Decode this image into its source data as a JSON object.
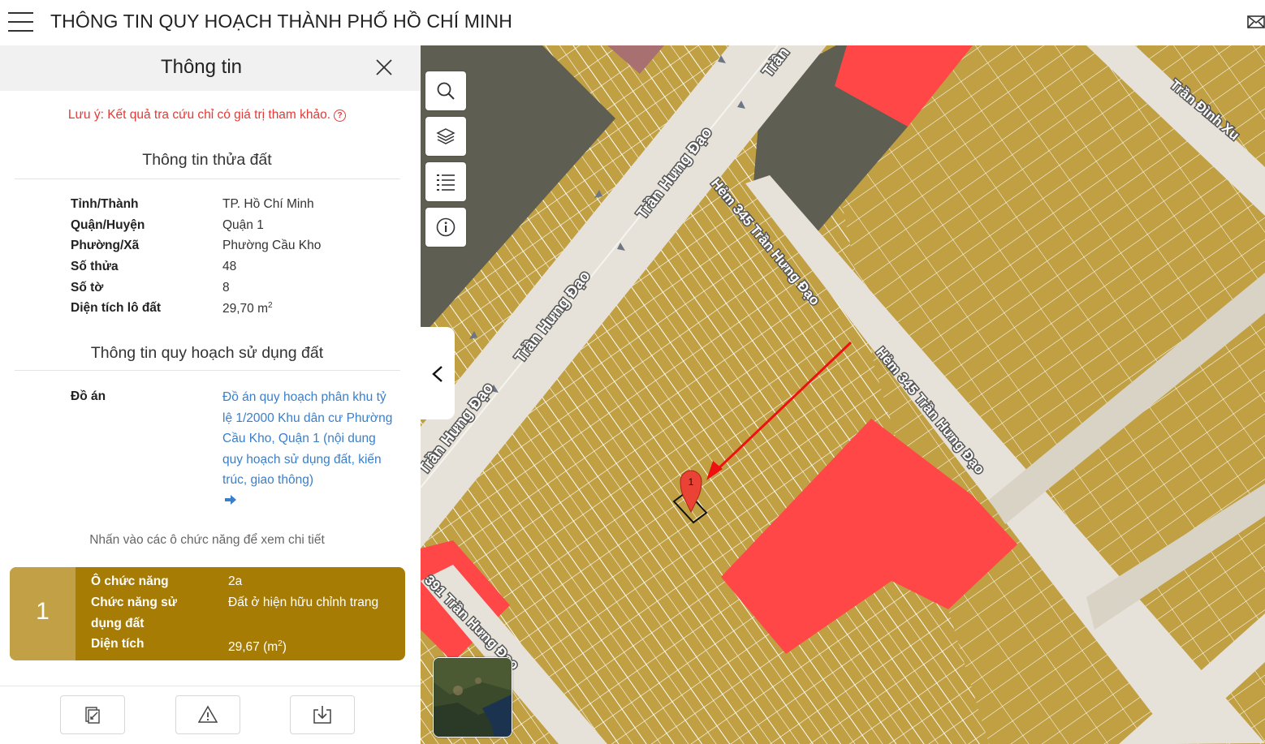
{
  "header": {
    "title": "THÔNG TIN QUY HOẠCH THÀNH PHỐ HỒ CHÍ MINH",
    "menu_icon": "hamburger-menu-icon",
    "mail_icon": "mail-icon"
  },
  "panel": {
    "title": "Thông tin",
    "note": "Lưu ý: Kết quả tra cứu chỉ có giá trị tham khảo.",
    "land_section_title": "Thông tin thửa đất",
    "land_info": [
      {
        "label": "Tỉnh/Thành",
        "value": "TP. Hồ Chí Minh"
      },
      {
        "label": "Quận/Huyện",
        "value": "Quận 1"
      },
      {
        "label": "Phường/Xã",
        "value": "Phường Cầu Kho"
      },
      {
        "label": "Số thửa",
        "value": "48"
      },
      {
        "label": "Số tờ",
        "value": "8"
      },
      {
        "label": "Diện tích lô đất",
        "value": "29,70 m",
        "value_sup": "2"
      }
    ],
    "planning_section_title": "Thông tin quy hoạch sử dụng đất",
    "project_label": "Đồ án",
    "project_link": "Đồ án quy hoạch phân khu tỷ lệ 1/2000 Khu dân cư Phường Cầu Kho, Quận 1 (nội dung quy hoạch sử dụng đất, kiến trúc, giao thông)",
    "hint": "Nhấn vào các ô chức năng để xem chi tiết",
    "function_card": {
      "number": "1",
      "color": "#a77c05",
      "rows": [
        {
          "label": "Ô chức năng",
          "value": "2a"
        },
        {
          "label": "Chức năng sử dụng đất",
          "value": "Đất ở hiện hữu chỉnh trang"
        },
        {
          "label": "Diện tích",
          "value": "29,67 (m",
          "value_sup": "2",
          "value_suffix": ")"
        }
      ]
    },
    "tools": [
      "document-edit-icon",
      "warning-icon",
      "download-icon"
    ]
  },
  "map": {
    "controls": [
      "search-icon",
      "layers-icon",
      "list-icon",
      "info-icon"
    ],
    "roads": [
      "Trần Hưng Đạo",
      "Trần Hưng Đạo",
      "Hẻm 345 Trần Hưng Đạo",
      "Hẻm 345 Trần Hưng Đạo",
      "391 Trần Hưng Đạo",
      "Trần Đình Xu",
      "Trần Hưng Đạo",
      "Trần"
    ],
    "marker_label": "1",
    "colors": {
      "residential": "#c0a043",
      "commercial": "#ff4747",
      "dark_zone": "#5e5e52",
      "road": "#e6e2da",
      "pink_zone": "#a87070"
    }
  }
}
